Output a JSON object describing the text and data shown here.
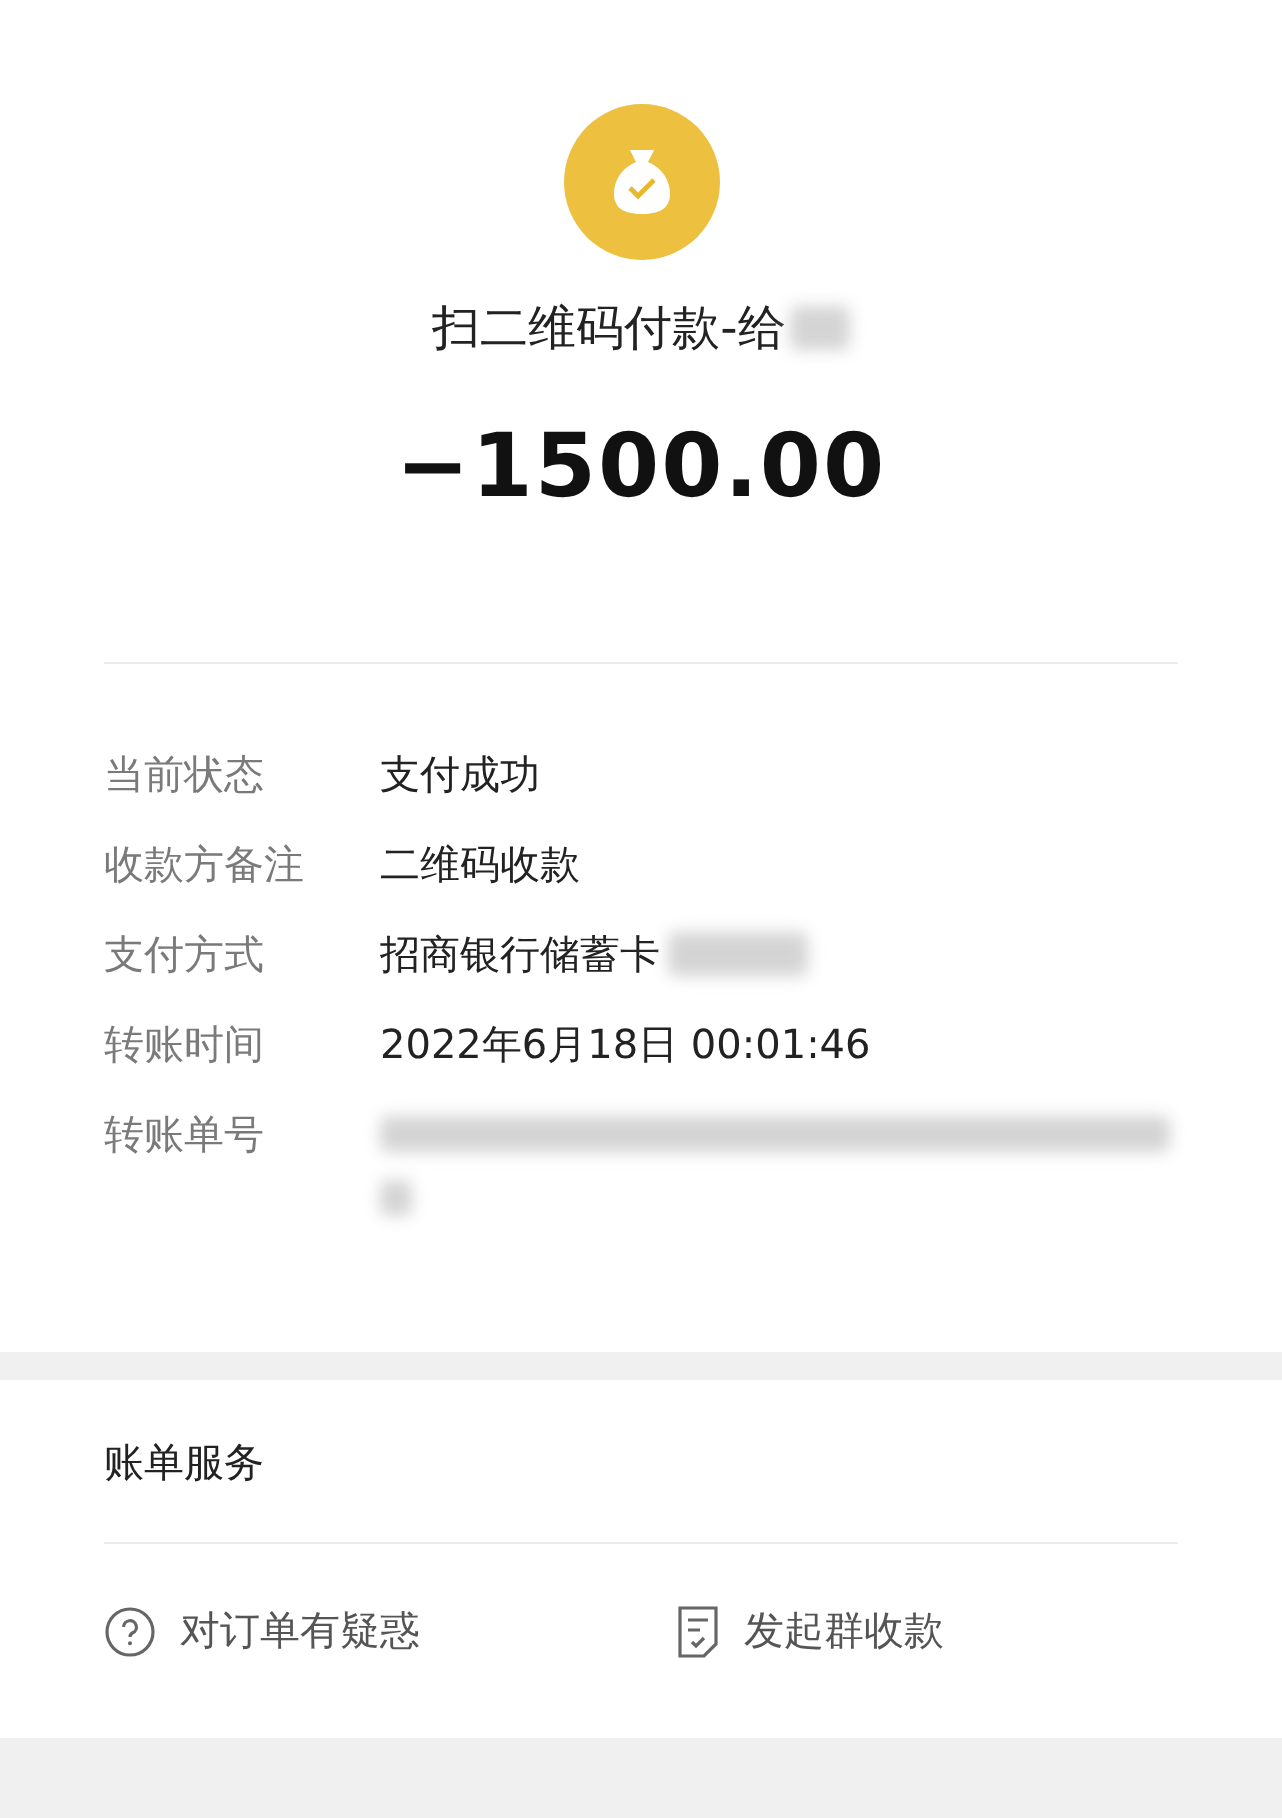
{
  "header": {
    "title": "扫二维码付款-给",
    "payee_redacted": true,
    "amount": "−1500.00"
  },
  "details": [
    {
      "label": "当前状态",
      "value": "支付成功"
    },
    {
      "label": "收款方备注",
      "value": "二维码收款"
    },
    {
      "label": "支付方式",
      "value": "招商银行储蓄卡",
      "redacted": true
    },
    {
      "label": "转账时间",
      "value": "2022年6月18日 00:01:46"
    },
    {
      "label": "转账单号",
      "redacted": true
    }
  ],
  "services": {
    "title": "账单服务",
    "actions": [
      {
        "kind": "help",
        "label": "对订单有疑惑"
      },
      {
        "kind": "group",
        "label": "发起群收款"
      }
    ]
  }
}
